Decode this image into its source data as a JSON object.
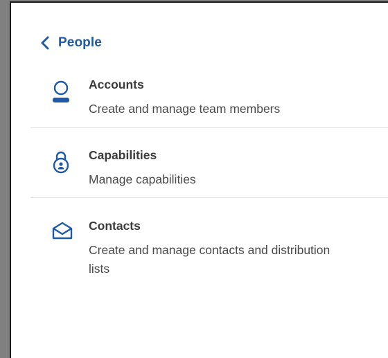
{
  "nav": {
    "back_label": "People",
    "back_icon": "chevron-left-icon"
  },
  "menu": {
    "items": [
      {
        "title": "Accounts",
        "description": "Create and manage team members",
        "icon": "user-icon"
      },
      {
        "title": "Capabilities",
        "description": "Manage capabilities",
        "icon": "lock-icon"
      },
      {
        "title": "Contacts",
        "description": "Create and manage contacts and distribution lists",
        "icon": "open-envelope-icon"
      }
    ]
  },
  "colors": {
    "accent": "#1f5aa8",
    "text_primary": "#3b3b3b",
    "text_secondary": "#4a4a4a",
    "divider": "#e2e2e2",
    "backdrop": "#808080"
  }
}
